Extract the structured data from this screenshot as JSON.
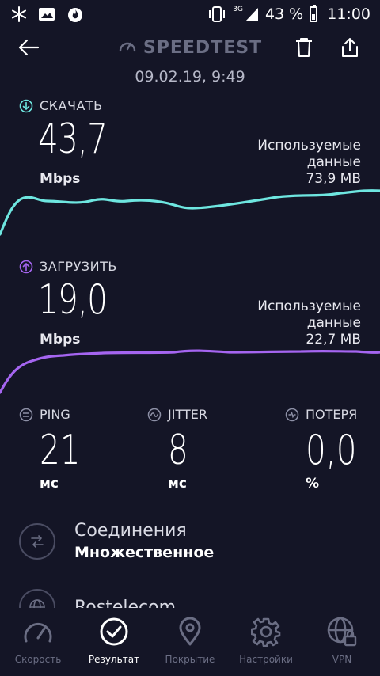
{
  "status_bar": {
    "network": "3G",
    "battery": "43 %",
    "time": "11:00"
  },
  "header": {
    "title": "SPEEDTEST",
    "datetime": "09.02.19, 9:49"
  },
  "download": {
    "label": "СКАЧАТЬ",
    "value": "43,7",
    "unit": "Mbps",
    "used_label_line1": "Используемые",
    "used_label_line2": "данные",
    "used_value": "73,9 MB",
    "color": "#6ee6e0"
  },
  "upload": {
    "label": "ЗАГРУЗИТЬ",
    "value": "19,0",
    "unit": "Mbps",
    "used_label_line1": "Используемые",
    "used_label_line2": "данные",
    "used_value": "22,7 MB",
    "color": "#a565f0"
  },
  "metrics": {
    "ping": {
      "label": "PING",
      "value": "21",
      "unit": "мс"
    },
    "jitter": {
      "label": "JITTER",
      "value": "8",
      "unit": "мс"
    },
    "loss": {
      "label": "ПОТЕРЯ",
      "value": "0,0",
      "unit": "%"
    }
  },
  "connections": {
    "title": "Соединения",
    "value": "Множественное"
  },
  "provider": {
    "title": "Rostelecom"
  },
  "nav": {
    "items": [
      {
        "label": "Скорость",
        "icon": "speedometer-icon"
      },
      {
        "label": "Результат",
        "icon": "check-circle-icon"
      },
      {
        "label": "Покрытие",
        "icon": "map-pin-icon"
      },
      {
        "label": "Настройки",
        "icon": "gear-icon"
      },
      {
        "label": "VPN",
        "icon": "vpn-globe-lock-icon"
      }
    ],
    "active": "Результат"
  }
}
